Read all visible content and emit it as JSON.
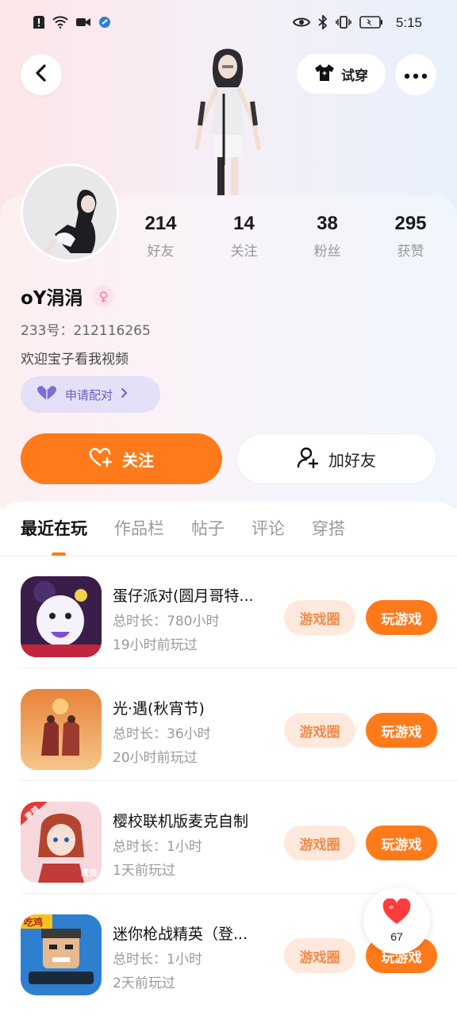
{
  "status_bar": {
    "time": "5:15"
  },
  "header": {
    "tryon_label": "试穿"
  },
  "stats": [
    {
      "value": "214",
      "label": "好友"
    },
    {
      "value": "14",
      "label": "关注"
    },
    {
      "value": "38",
      "label": "粉丝"
    },
    {
      "value": "295",
      "label": "获赞"
    }
  ],
  "profile": {
    "name": "oY涓涓",
    "gender_symbol": "♀",
    "uid": "233号：212116265",
    "bio": "欢迎宝子看我视频",
    "pair_label": "申请配对"
  },
  "actions": {
    "follow_label": "关注",
    "add_friend_label": "加好友"
  },
  "tabs": [
    "最近在玩",
    "作品栏",
    "帖子",
    "评论",
    "穿搭"
  ],
  "games": [
    {
      "name": "蛋仔派对(圆月哥特...",
      "total": "总时长：780小时",
      "last": "19小时前玩过",
      "circle_label": "游戏圈",
      "play_label": "玩游戏"
    },
    {
      "name": "光·遇(秋宵节)",
      "total": "总时长：36小时",
      "last": "20小时前玩过",
      "circle_label": "游戏圈",
      "play_label": "玩游戏"
    },
    {
      "name": "樱校联机版麦克自制",
      "total": "总时长：1小时",
      "last": "1天前玩过",
      "circle_label": "游戏圈",
      "play_label": "玩游戏"
    },
    {
      "name": "迷你枪战精英（登...",
      "total": "总时长：1小时",
      "last": "2天前玩过",
      "circle_label": "游戏圈",
      "play_label": "玩游戏"
    }
  ],
  "game_icon_badges": {
    "game3_top": "麦萌",
    "game3_bottom": "麦克",
    "game4_top": "吃鸡"
  },
  "like": {
    "count": "67"
  },
  "colors": {
    "accent": "#ff7a1a",
    "pair": "#6b5fc8",
    "circle_btn_bg": "#ffe9dc"
  }
}
